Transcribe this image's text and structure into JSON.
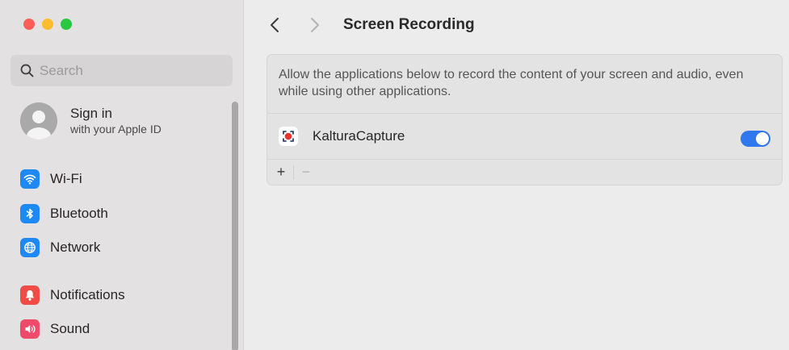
{
  "window": {
    "traffic_lights": [
      "close",
      "minimize",
      "zoom"
    ]
  },
  "sidebar": {
    "search": {
      "placeholder": "Search"
    },
    "account": {
      "title": "Sign in",
      "subtitle": "with your Apple ID"
    },
    "items": [
      {
        "label": "Wi-Fi",
        "icon": "wifi-icon",
        "color": "#1e88f5"
      },
      {
        "label": "Bluetooth",
        "icon": "bluetooth-icon",
        "color": "#1e88f5"
      },
      {
        "label": "Network",
        "icon": "globe-icon",
        "color": "#1e88f5"
      },
      {
        "label": "Notifications",
        "icon": "bell-icon",
        "color": "#ef4c46"
      },
      {
        "label": "Sound",
        "icon": "speaker-icon",
        "color": "#ee4b6a"
      }
    ]
  },
  "toolbar": {
    "back": "<",
    "forward": ">",
    "title": "Screen Recording"
  },
  "panel": {
    "description": "Allow the applications below to record the content of your screen and audio, even while using other applications.",
    "apps": [
      {
        "name": "KalturaCapture",
        "enabled": true
      }
    ],
    "add_label": "+",
    "remove_label": "−"
  },
  "colors": {
    "accent": "#2f78ee",
    "sidebar_bg": "#e3e1e1",
    "content_bg": "#ececec"
  }
}
